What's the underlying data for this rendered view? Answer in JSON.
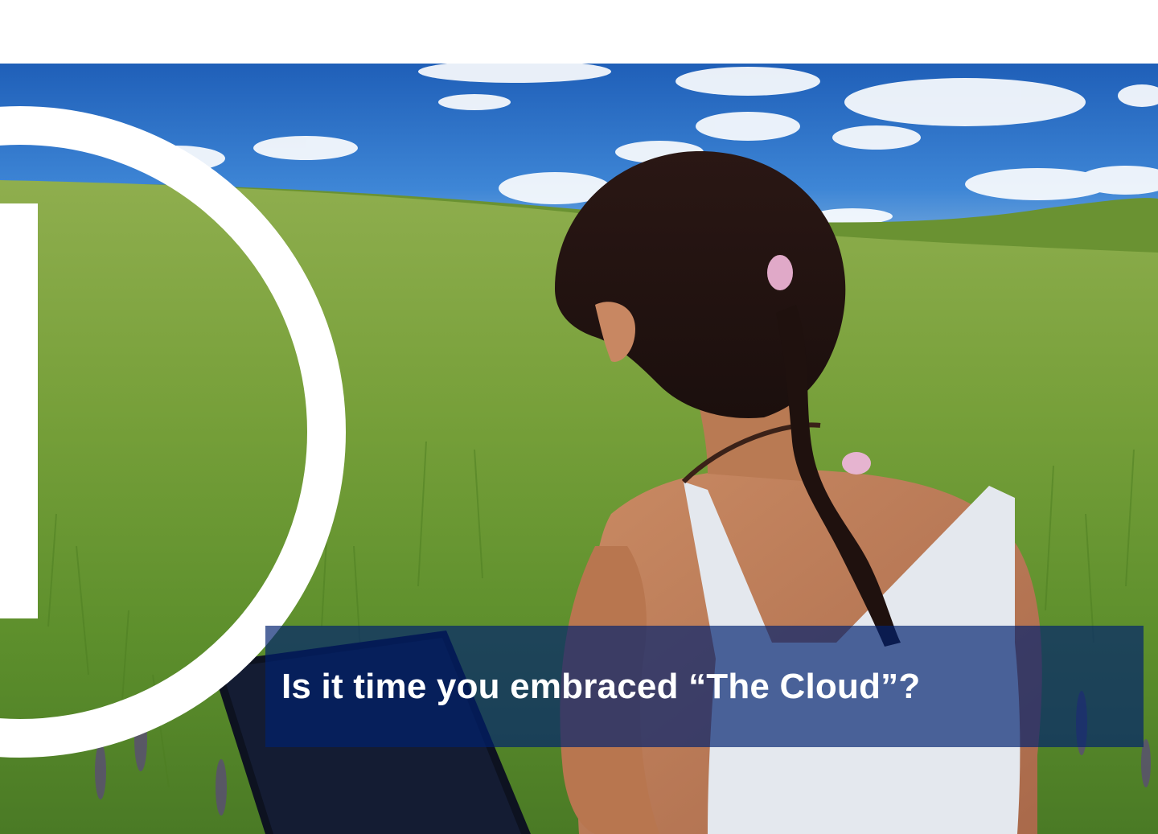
{
  "slide": {
    "headline": "Is it time you embraced “The Cloud”?"
  },
  "photo": {
    "subject": "woman-with-laptop-in-field-photo"
  },
  "logo": {
    "icon": "ring-and-bar-logo-icon",
    "color": "#ffffff"
  },
  "colors": {
    "caption_background": "#00206e",
    "caption_text": "#ffffff",
    "sky": "#2f6fc4",
    "grass": "#6e9a2e"
  }
}
